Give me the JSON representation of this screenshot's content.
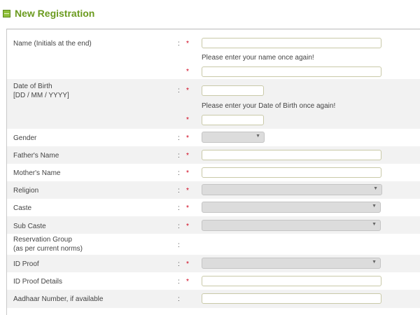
{
  "header": {
    "title": "New Registration",
    "icon": "minus-box-icon"
  },
  "form": {
    "colon": ":",
    "required": "*",
    "fields": {
      "name": {
        "label": "Name (Initials at the end)",
        "confirm_note": "Please enter your name once again!"
      },
      "dob": {
        "label_line1": "Date of Birth",
        "label_line2": "[DD / MM / YYYY]",
        "confirm_note": "Please enter your Date of Birth once again!"
      },
      "gender": {
        "label": "Gender"
      },
      "father": {
        "label": "Father's Name"
      },
      "mother": {
        "label": "Mother's Name"
      },
      "religion": {
        "label": "Religion"
      },
      "caste": {
        "label": "Caste"
      },
      "subcaste": {
        "label": "Sub Caste"
      },
      "reservation": {
        "label_line1": "Reservation Group",
        "label_line2": "(as per current norms)"
      },
      "idproof": {
        "label": "ID Proof"
      },
      "idproof_details": {
        "label": "ID Proof Details"
      },
      "aadhaar": {
        "label": "Aadhaar Number, if available"
      }
    }
  },
  "colors": {
    "title_green": "#6b9b1f",
    "required_red": "#d0021b",
    "alt_row": "#f2f2f2"
  },
  "select_arrow_icon": "▼"
}
